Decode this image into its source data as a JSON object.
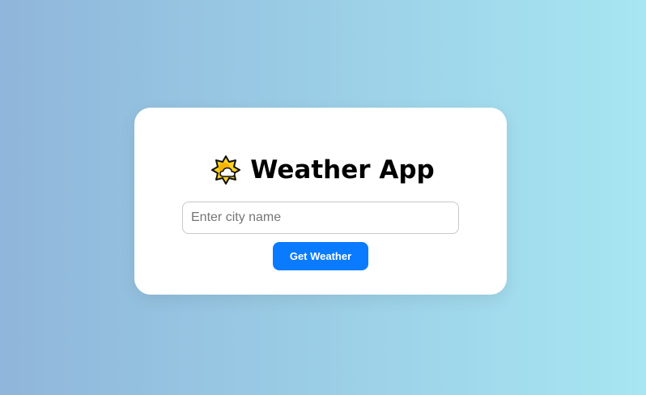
{
  "app": {
    "title": "Weather App",
    "title_icon": "sun-behind-cloud-icon"
  },
  "search": {
    "placeholder": "Enter city name",
    "value": ""
  },
  "actions": {
    "get_weather_label": "Get Weather"
  },
  "colors": {
    "background_start": "#8fb6da",
    "background_end": "#a7e6f2",
    "card": "#ffffff",
    "button": "#0a7bff",
    "button_text": "#ffffff",
    "sun": "#ffd21f",
    "cloud": "#ffffff"
  }
}
